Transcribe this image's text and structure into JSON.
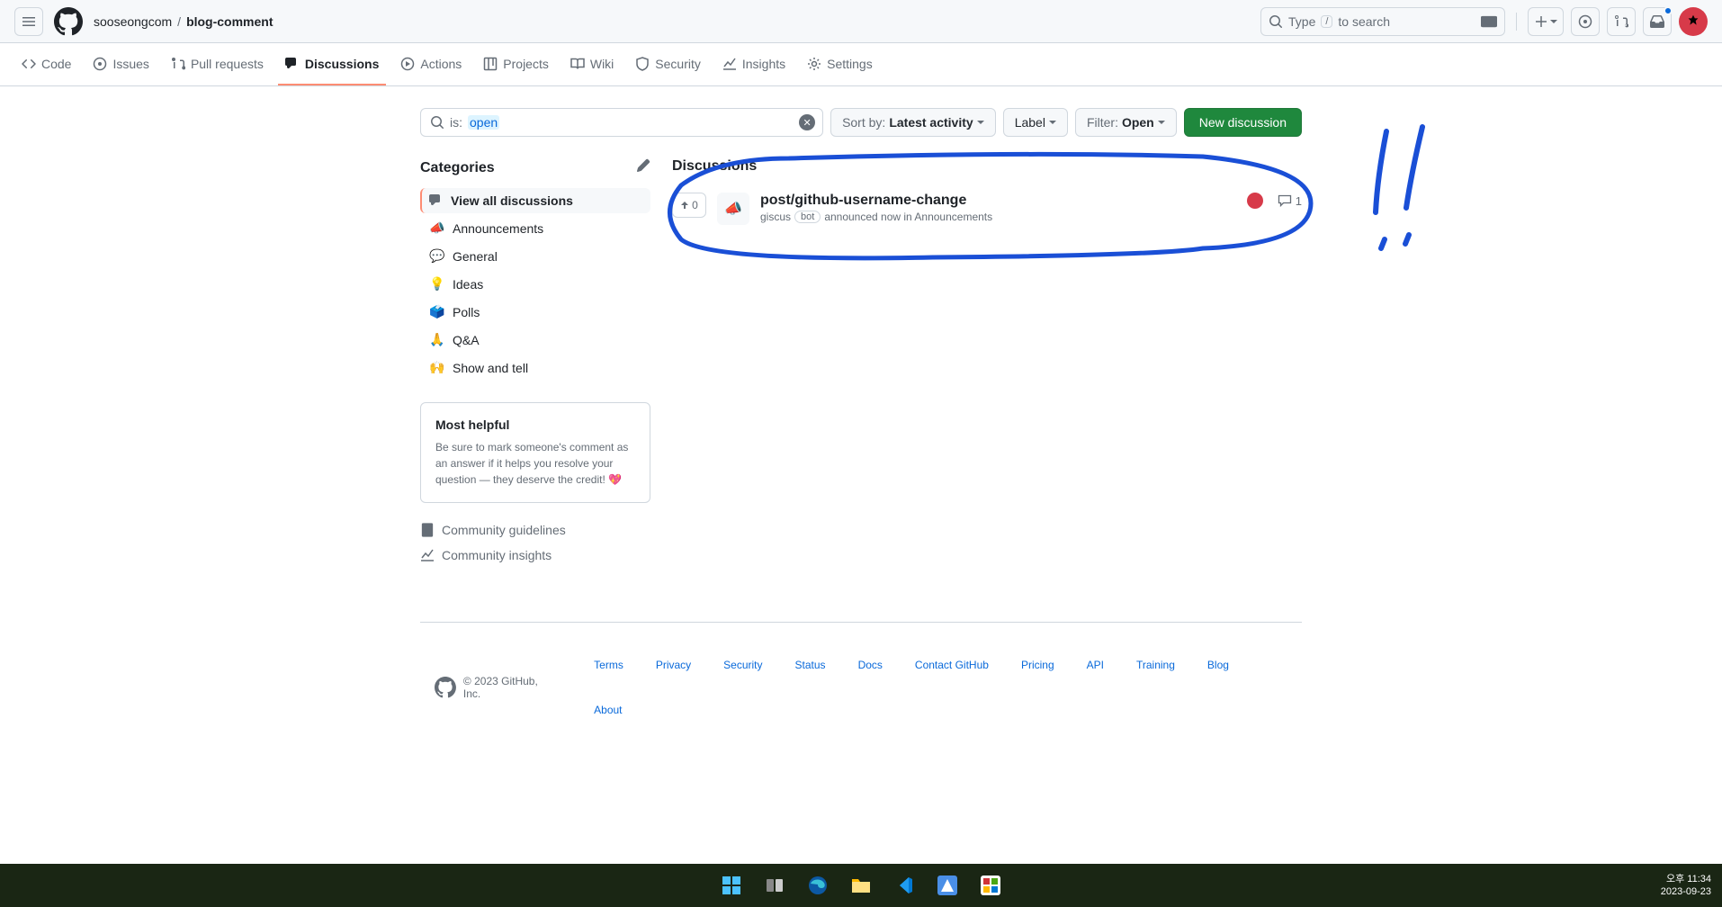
{
  "header": {
    "owner": "sooseongcom",
    "repo": "blog-comment",
    "search_placeholder_prefix": "Type ",
    "search_placeholder_key": "/",
    "search_placeholder_suffix": " to search"
  },
  "tabs": {
    "code": "Code",
    "issues": "Issues",
    "pull_requests": "Pull requests",
    "discussions": "Discussions",
    "actions": "Actions",
    "projects": "Projects",
    "wiki": "Wiki",
    "security": "Security",
    "insights": "Insights",
    "settings": "Settings"
  },
  "filters": {
    "query_prefix": "is:",
    "query_value": "open",
    "sort_label": "Sort by: ",
    "sort_value": "Latest activity",
    "label_btn": "Label",
    "filter_label": "Filter: ",
    "filter_value": "Open",
    "new_btn": "New discussion"
  },
  "sidebar": {
    "categories_title": "Categories",
    "items": {
      "all": "View all discussions",
      "announcements": "Announcements",
      "general": "General",
      "ideas": "Ideas",
      "polls": "Polls",
      "qa": "Q&A",
      "show": "Show and tell"
    },
    "help_title": "Most helpful",
    "help_text": "Be sure to mark someone's comment as an answer if it helps you resolve your question — they deserve the credit! ",
    "help_heart": "💖",
    "community_guidelines": "Community guidelines",
    "community_insights": "Community insights"
  },
  "discussions": {
    "title": "Discussions",
    "items": [
      {
        "title": "post/github-username-change",
        "upvotes": "0",
        "author": "giscus",
        "bot_label": "bot",
        "meta_rest": "announced now in Announcements",
        "category_emoji": "📣",
        "comments": "1"
      }
    ]
  },
  "footer": {
    "copyright": "© 2023 GitHub, Inc.",
    "links": [
      "Terms",
      "Privacy",
      "Security",
      "Status",
      "Docs",
      "Contact GitHub",
      "Pricing",
      "API",
      "Training",
      "Blog",
      "About"
    ]
  },
  "taskbar": {
    "time": "오후 11:34",
    "date": "2023-09-23"
  }
}
